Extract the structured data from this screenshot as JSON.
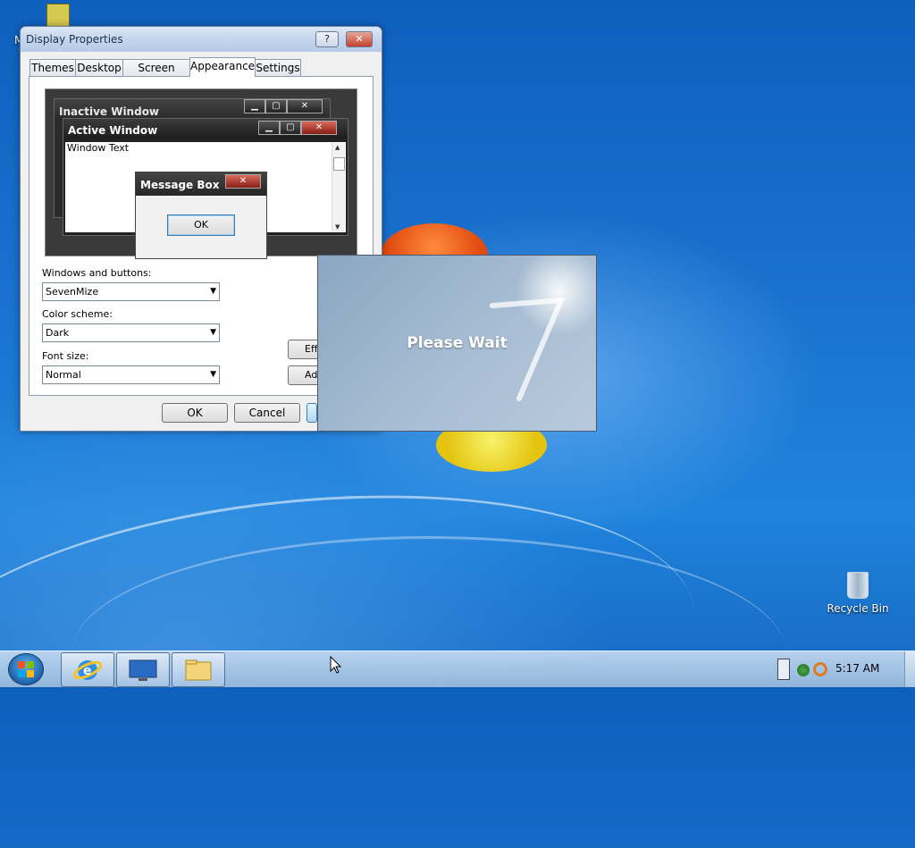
{
  "desktop": {
    "icons": [
      {
        "label": "M"
      },
      {
        "label": "Recycle Bin"
      }
    ]
  },
  "dialog": {
    "title": "Display Properties",
    "help_label": "?",
    "close_label": "✕",
    "tabs": [
      "Themes",
      "Desktop",
      "Screen Saver",
      "Appearance",
      "Settings"
    ],
    "active_tab": "Appearance",
    "preview": {
      "inactive_title": "Inactive Window",
      "active_title": "Active Window",
      "window_text": "Window Text",
      "message_box_title": "Message Box",
      "message_box_ok": "OK"
    },
    "windows_buttons_label": "Windows and buttons:",
    "windows_buttons_value": "SevenMize",
    "color_scheme_label": "Color scheme:",
    "color_scheme_value": "Dark",
    "font_size_label": "Font size:",
    "font_size_value": "Normal",
    "effects_button": "Effe",
    "advanced_button": "Adv",
    "ok_button": "OK",
    "cancel_button": "Cancel"
  },
  "splash": {
    "text": "Please Wait"
  },
  "taskbar": {
    "apps": [
      "internet-explorer-icon",
      "display-icon",
      "folder-icon"
    ],
    "clock": "5:17 AM"
  }
}
